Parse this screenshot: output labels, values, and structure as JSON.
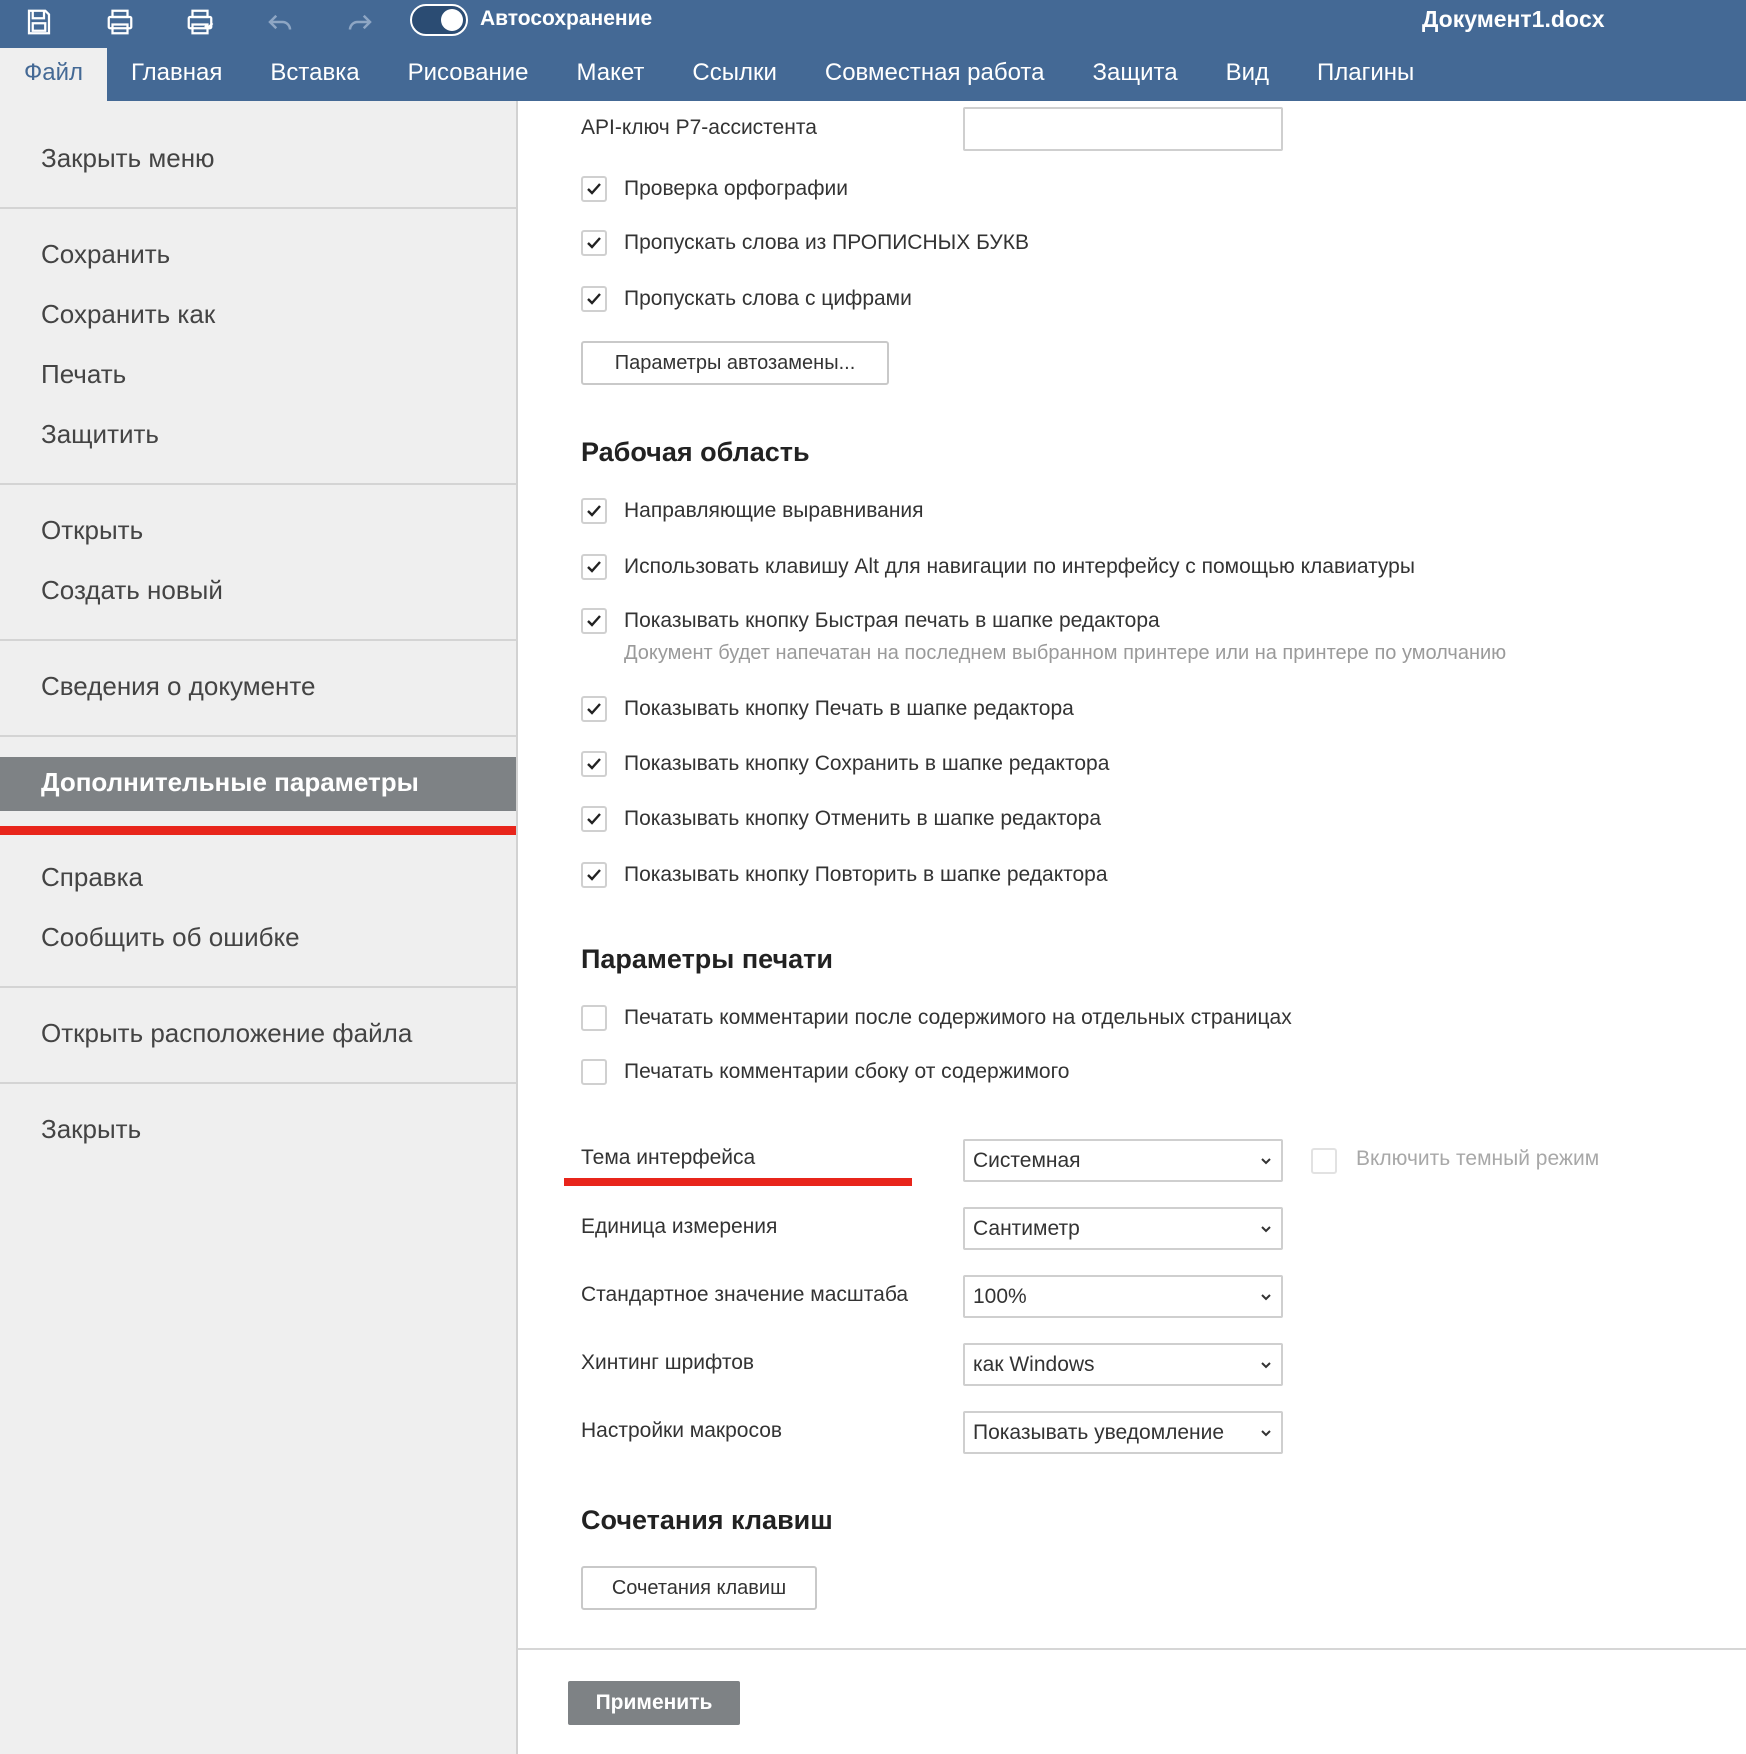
{
  "titlebar": {
    "autosave_label": "Автосохранение",
    "autosave_on": true,
    "document_title": "Документ1.docx",
    "quick_access_icons": [
      "save-icon",
      "print-icon",
      "quick-print-icon",
      "undo-icon",
      "redo-icon"
    ]
  },
  "tabs": [
    {
      "label": "Файл",
      "active": true
    },
    {
      "label": "Главная"
    },
    {
      "label": "Вставка"
    },
    {
      "label": "Рисование"
    },
    {
      "label": "Макет"
    },
    {
      "label": "Ссылки"
    },
    {
      "label": "Совместная работа"
    },
    {
      "label": "Защита"
    },
    {
      "label": "Вид"
    },
    {
      "label": "Плагины"
    }
  ],
  "menu": {
    "close_menu": "Закрыть меню",
    "save": "Сохранить",
    "save_as": "Сохранить как",
    "print": "Печать",
    "protect": "Защитить",
    "open": "Открыть",
    "create_new": "Создать новый",
    "doc_info": "Сведения о документе",
    "advanced": "Дополнительные параметры",
    "help": "Справка",
    "report_bug": "Сообщить об ошибке",
    "open_location": "Открыть расположение файла",
    "close": "Закрыть"
  },
  "settings": {
    "api_key_label": "API-ключ Р7-ассистента",
    "api_key_value": "",
    "spellcheck": {
      "label": "Проверка орфографии",
      "checked": true
    },
    "skip_upper": {
      "label": "Пропускать слова из ПРОПИСНЫХ БУКВ",
      "checked": true
    },
    "skip_digits": {
      "label": "Пропускать слова с цифрами",
      "checked": true
    },
    "autocorrect_button": "Параметры автозамены...",
    "workspace_title": "Рабочая область",
    "guides": {
      "label": "Направляющие выравнивания",
      "checked": true
    },
    "alt_nav": {
      "label": "Использовать клавишу Alt для навигации по интерфейсу с помощью клавиатуры",
      "checked": true
    },
    "quick_print": {
      "label": "Показывать кнопку Быстрая печать в шапке редактора",
      "checked": true
    },
    "quick_print_hint": "Документ будет напечатан на последнем выбранном принтере или на принтере по умолчанию",
    "show_print": {
      "label": "Показывать кнопку Печать в шапке редактора",
      "checked": true
    },
    "show_save": {
      "label": "Показывать кнопку Сохранить в шапке редактора",
      "checked": true
    },
    "show_undo": {
      "label": "Показывать кнопку Отменить в шапке редактора",
      "checked": true
    },
    "show_redo": {
      "label": "Показывать кнопку Повторить в шапке редактора",
      "checked": true
    },
    "print_title": "Параметры печати",
    "print_comments_after": {
      "label": "Печатать комментарии после содержимого на отдельных страницах",
      "checked": false
    },
    "print_comments_side": {
      "label": "Печатать комментарии сбоку от содержимого",
      "checked": false
    },
    "theme_label": "Тема интерфейса",
    "theme_value": "Системная",
    "dark_mode": {
      "label": "Включить темный режим",
      "checked": false,
      "disabled": true
    },
    "unit_label": "Единица измерения",
    "unit_value": "Сантиметр",
    "zoom_label": "Стандартное значение масштаба",
    "zoom_value": "100%",
    "hinting_label": "Хинтинг шрифтов",
    "hinting_value": "как Windows",
    "macros_label": "Настройки макросов",
    "macros_value": "Показывать уведомление",
    "shortcuts_title": "Сочетания клавиш",
    "shortcuts_button": "Сочетания клавиш",
    "apply_button": "Применить"
  },
  "colors": {
    "header": "#446995",
    "sidebar": "#efefef",
    "active_item": "#7e8285",
    "annotation_red": "#e8251b"
  }
}
